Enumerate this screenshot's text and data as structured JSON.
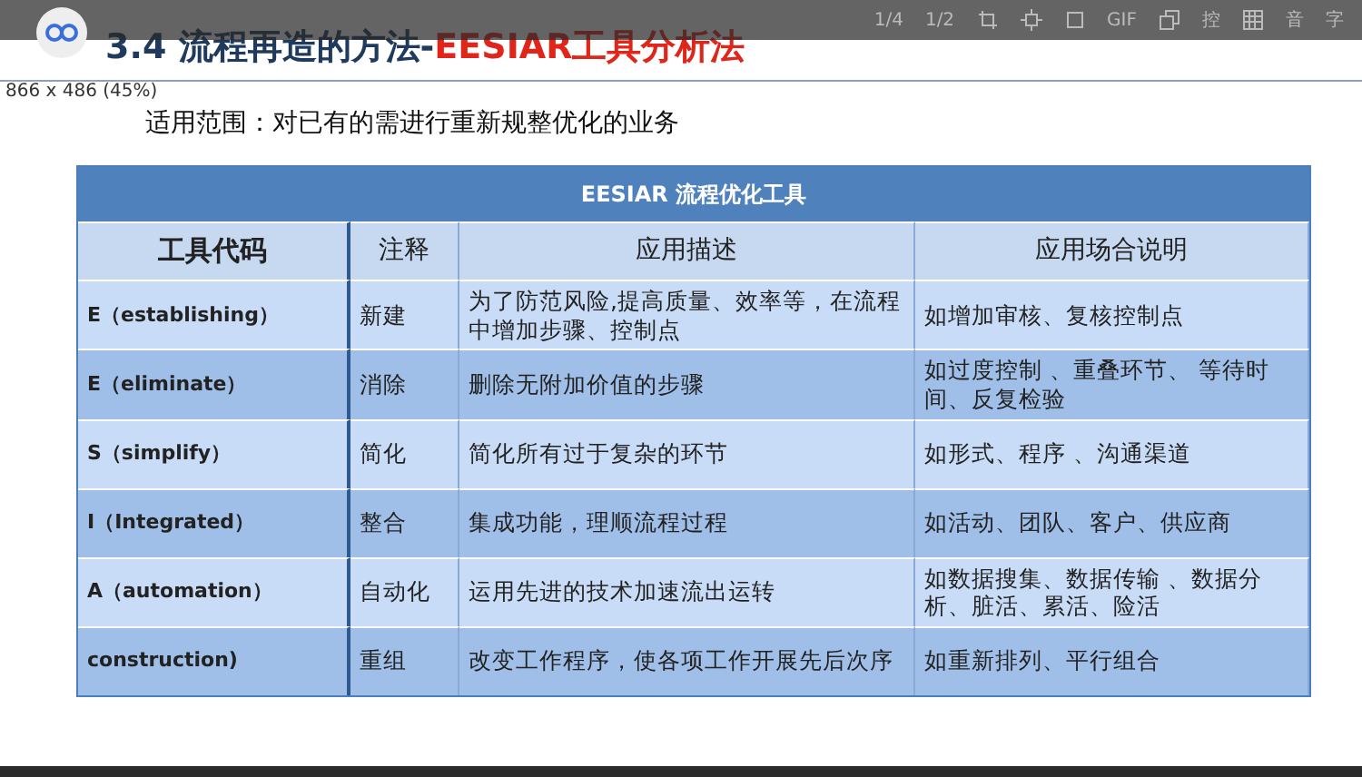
{
  "viewer": {
    "size_info": "866 x 486 (45%)",
    "toolbar": [
      {
        "kind": "text",
        "label": "1/4"
      },
      {
        "kind": "text",
        "label": "1/2"
      },
      {
        "kind": "icon"
      },
      {
        "kind": "icon"
      },
      {
        "kind": "icon"
      },
      {
        "kind": "text",
        "label": "GIF"
      },
      {
        "kind": "icon"
      },
      {
        "kind": "text",
        "label": "控"
      },
      {
        "kind": "icon"
      },
      {
        "kind": "text",
        "label": "音"
      },
      {
        "kind": "text",
        "label": "字"
      }
    ]
  },
  "slide": {
    "title_prefix": "3.4 流程再造的方法-",
    "title_highlight": "EESIAR工具分析法",
    "subtitle": "适用范围：对已有的需进行重新规整优化的业务",
    "table": {
      "caption": "EESIAR 流程优化工具",
      "columns": [
        "工具代码",
        "注释",
        "应用描述",
        "应用场合说明"
      ],
      "rows": [
        {
          "code": "E（establishing）",
          "note": "新建",
          "description": "为了防范风险,提高质量、效率等，在流程中增加步骤、控制点",
          "usage": "如增加审核、复核控制点"
        },
        {
          "code": "E（eliminate）",
          "note": "消除",
          "description": "删除无附加价值的步骤",
          "usage": "如过度控制 、重叠环节、 等待时间、反复检验"
        },
        {
          "code": "S（simplify）",
          "note": "简化",
          "description": "简化所有过于复杂的环节",
          "usage": "如形式、程序 、沟通渠道"
        },
        {
          "code": "I（Integrated）",
          "note": "整合",
          "description": "集成功能，理顺流程过程",
          "usage": "如活动、团队、客户、供应商"
        },
        {
          "code": "A（automation）",
          "note": "自动化",
          "description": "运用先进的技术加速流出运转",
          "usage": "如数据搜集、数据传输 、数据分析、脏活、累活、险活"
        },
        {
          "code": "construction)",
          "note": "重组",
          "description": "改变工作程序，使各项工作开展先后次序",
          "usage": "如重新排列、平行组合"
        }
      ]
    }
  }
}
